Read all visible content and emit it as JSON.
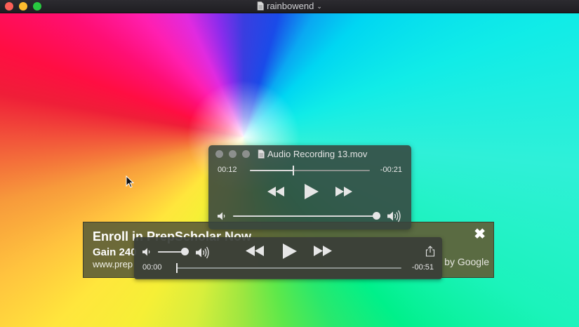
{
  "window": {
    "title": "rainbowend",
    "colors": {
      "close": "#fc5f57",
      "minimize": "#fdbc2e",
      "zoom": "#28c840"
    }
  },
  "ad": {
    "title": "Enroll in PrepScholar Now",
    "line2": "Gain 240",
    "url": "www.prep",
    "attribution": "by Google",
    "close_icon": "close-x-icon"
  },
  "audio_panel": {
    "title": "Audio Recording 13.mov",
    "elapsed": "00:12",
    "remaining": "-00:21",
    "progress_fraction": 0.36,
    "volume_fraction": 1.0,
    "icons": [
      "file-icon",
      "rewind-icon",
      "play-icon",
      "fast-forward-icon",
      "volume-low-icon",
      "volume-high-icon"
    ]
  },
  "controller": {
    "elapsed": "00:00",
    "remaining": "-00:51",
    "progress_fraction": 0.0,
    "volume_fraction": 0.95,
    "icons": [
      "volume-low-icon",
      "volume-high-icon",
      "rewind-icon",
      "play-icon",
      "fast-forward-icon",
      "share-icon"
    ]
  }
}
